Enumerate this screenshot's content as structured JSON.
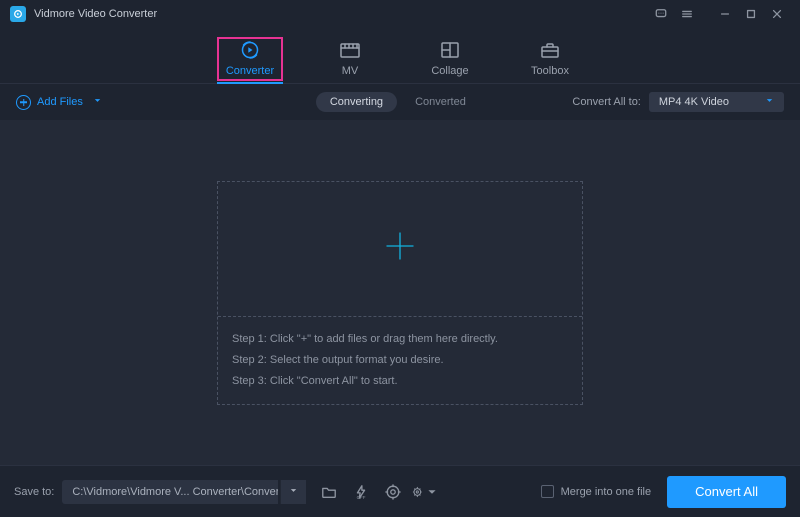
{
  "app": {
    "title": "Vidmore Video Converter"
  },
  "nav": {
    "items": [
      {
        "label": "Converter",
        "active": true
      },
      {
        "label": "MV"
      },
      {
        "label": "Collage"
      },
      {
        "label": "Toolbox"
      }
    ]
  },
  "toolbar": {
    "add_files": "Add Files",
    "seg_converting": "Converting",
    "seg_converted": "Converted",
    "convert_all_to_label": "Convert All to:",
    "format_selected": "MP4 4K Video"
  },
  "drop": {
    "step1": "Step 1: Click \"+\" to add files or drag them here directly.",
    "step2": "Step 2: Select the output format you desire.",
    "step3": "Step 3: Click \"Convert All\" to start."
  },
  "footer": {
    "save_to_label": "Save to:",
    "path": "C:\\Vidmore\\Vidmore V... Converter\\Converted",
    "merge_label": "Merge into one file",
    "convert_all_btn": "Convert All"
  }
}
